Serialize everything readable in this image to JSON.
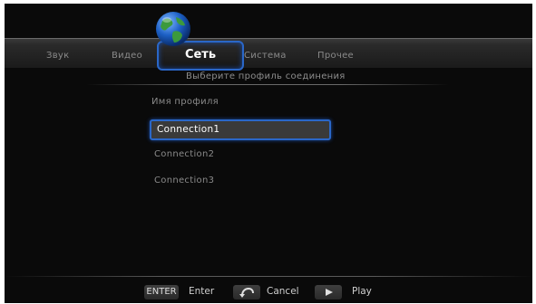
{
  "menu": {
    "tabs": [
      "Звук",
      "Видео",
      "Сеть",
      "Система",
      "Прочее"
    ],
    "active_tab": "Сеть"
  },
  "subtitle": "Выберите профиль соединения",
  "profile": {
    "heading": "Имя профиля",
    "connections": [
      "Connection1",
      "Connection2",
      "Connection3"
    ],
    "selected": "Connection1"
  },
  "hints": {
    "enter_key": "ENTER",
    "enter_label": "Enter",
    "cancel_label": "Cancel",
    "play_label": "Play"
  },
  "colors": {
    "highlight": "#2a67c8",
    "background": "#0a0a0a"
  },
  "icons": {
    "network": "globe-icon",
    "cancel": "return-icon",
    "play": "play-icon"
  }
}
